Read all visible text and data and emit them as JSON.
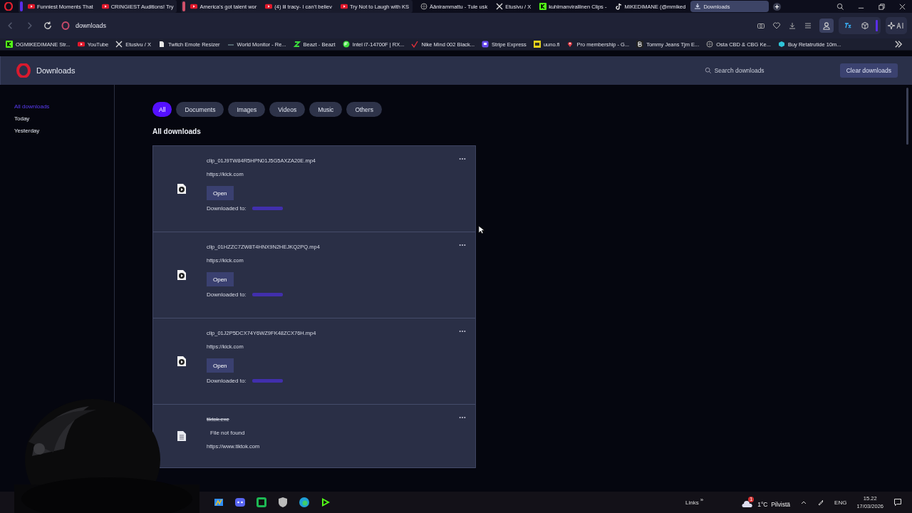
{
  "browser": {
    "tab_groups": [
      {
        "color": "#5a2ee8",
        "tabs": [
          {
            "title": "Funniest Moments That",
            "kind": "youtube",
            "selected": false
          },
          {
            "title": "CRINGIEST Auditions! Try",
            "kind": "youtube",
            "selected": false
          }
        ]
      },
      {
        "color": "#d0506a",
        "tabs": [
          {
            "title": "America's got talent wor",
            "kind": "youtube",
            "selected": false
          },
          {
            "title": "(4) lil tracy- I can't believ",
            "kind": "youtube",
            "selected": false
          },
          {
            "title": "Try Not to Laugh with KS",
            "kind": "youtube",
            "selected": false
          }
        ]
      }
    ],
    "tabs": [
      {
        "title": "Äänirammattu - Tule usk",
        "kind": "web",
        "selected": false
      },
      {
        "title": "Etusivu / X",
        "kind": "x",
        "selected": false
      },
      {
        "title": "kuhlmanvirallinen Clips -",
        "kind": "kick",
        "selected": false
      },
      {
        "title": "MIKEDIMANE (@mmiked",
        "kind": "tiktok",
        "selected": false
      },
      {
        "title": "Downloads",
        "kind": "download",
        "selected": true
      }
    ],
    "address": "downloads",
    "bookmarks": [
      {
        "title": "OGMIKEDIMANE Str...",
        "kind": "kick"
      },
      {
        "title": "YouTube",
        "kind": "youtube"
      },
      {
        "title": "Etusivu / X",
        "kind": "x"
      },
      {
        "title": "Twitch Emote Resizer",
        "kind": "file"
      },
      {
        "title": "World Monitor - Re...",
        "kind": "dash"
      },
      {
        "title": "Beazt - Beazt",
        "kind": "green"
      },
      {
        "title": "Intel i7-14700F | RX...",
        "kind": "green-circle"
      },
      {
        "title": "Nike Mind 002 Black...",
        "kind": "check"
      },
      {
        "title": "Stripe Express",
        "kind": "purple"
      },
      {
        "title": "uuno.fi",
        "kind": "yellow"
      },
      {
        "title": "Pro membership - G...",
        "kind": "pin"
      },
      {
        "title": "Tommy Jeans Tjm E...",
        "kind": "letter"
      },
      {
        "title": "Osta CBD & CBG Ke...",
        "kind": "web"
      },
      {
        "title": "Buy Retatrutide 10m...",
        "kind": "cube"
      }
    ]
  },
  "header": {
    "title": "Downloads",
    "search": {
      "placeholder": "Search downloads"
    },
    "clear_button": "Clear downloads"
  },
  "sidebar": {
    "items": [
      {
        "label": "All downloads",
        "selected": true
      },
      {
        "label": "Today",
        "selected": false
      },
      {
        "label": "Yesterday",
        "selected": false
      }
    ]
  },
  "filters": [
    {
      "label": "All",
      "selected": true
    },
    {
      "label": "Documents",
      "selected": false
    },
    {
      "label": "Images",
      "selected": false
    },
    {
      "label": "Videos",
      "selected": false
    },
    {
      "label": "Music",
      "selected": false
    },
    {
      "label": "Others",
      "selected": false
    }
  ],
  "section_title": "All downloads",
  "downloads": [
    {
      "kind": "video",
      "filename": "clip_01J9TW84R5HPN01J5G5AXZA20E.mp4",
      "source": "https://kick.com",
      "button": "Open",
      "location_label": "Downloaded to:"
    },
    {
      "kind": "video",
      "filename": "clip_01HZZC7ZW8T4HNX9N2HEJKQ2PQ.mp4",
      "source": "https://kick.com",
      "button": "Open",
      "location_label": "Downloaded to:"
    },
    {
      "kind": "video",
      "filename": "clip_01J2P5DCX74Y6WZ9FK48ZCX76H.mp4",
      "source": "https://kick.com",
      "button": "Open",
      "location_label": "Downloaded to:"
    },
    {
      "kind": "missing",
      "filename": "tiktok.exe",
      "status": "File not found",
      "source": "https://www.tiktok.com"
    }
  ],
  "taskbar": {
    "links": "Links",
    "links_more": "»",
    "weather_badge": "1",
    "weather": "1°C  Pilvistä",
    "language": "ENG",
    "time": "15.22",
    "date": "17/03/2026"
  }
}
